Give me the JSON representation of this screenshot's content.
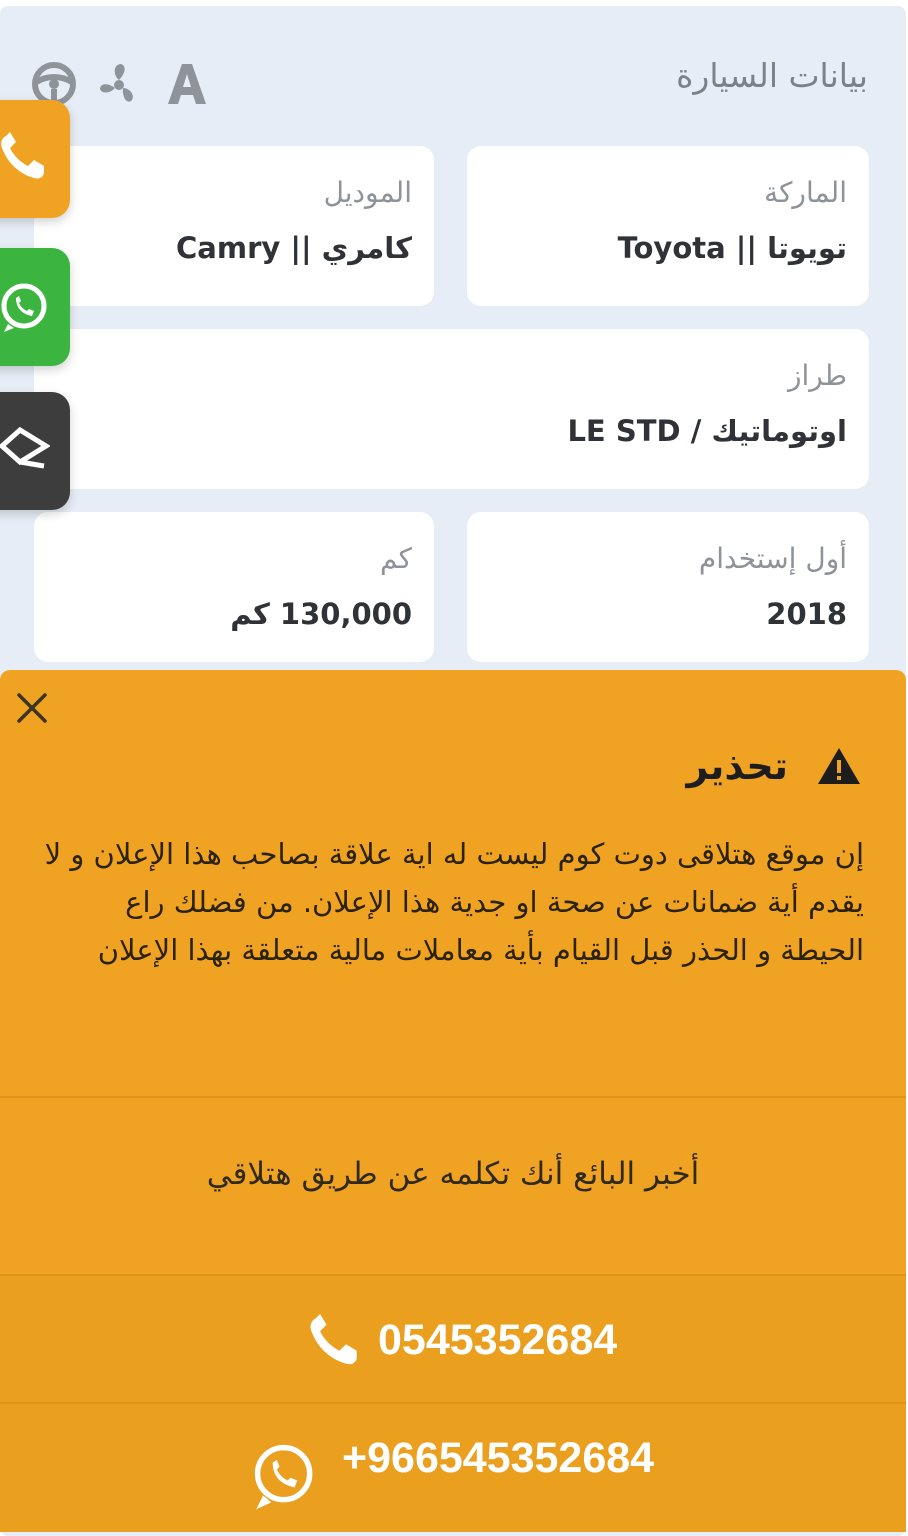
{
  "section": {
    "title": "بيانات السيارة",
    "spec_icons": [
      "steering-wheel-icon",
      "fan-icon",
      "letter-a-icon"
    ]
  },
  "fields": {
    "make": {
      "label": "الماركة",
      "value": "تويوتا || Toyota"
    },
    "model": {
      "label": "الموديل",
      "value": "كامري || Camry"
    },
    "trim": {
      "label": "طراز",
      "value": "اوتوماتيك / LE STD"
    },
    "first_use": {
      "label": "أول إستخدام",
      "value": "2018"
    },
    "km": {
      "label": "كم",
      "value": "130,000 كم"
    }
  },
  "floating_buttons": [
    {
      "icon": "phone-icon",
      "color": "#f0a322"
    },
    {
      "icon": "whatsapp-icon",
      "color": "#3bb53f"
    },
    {
      "icon": "share-icon",
      "color": "#3d3d3d"
    }
  ],
  "warning": {
    "title": "تحذير",
    "body": "إن موقع هتلاقى دوت كوم ليست له اية علاقة بصاحب هذا الإعلان و لا يقدم أية ضمانات عن صحة او جدية هذا الإعلان. من فضلك راع الحيطة و الحذر قبل القيام بأية معاملات مالية متعلقة بهذا الإعلان",
    "tell_seller": "أخبر البائع أنك تكلمه عن طريق هتلاقي",
    "phone": "0545352684",
    "whatsapp": "+966545352684"
  },
  "colors": {
    "background": "#e7edf6",
    "warning": "#f0a322",
    "whatsapp": "#3bb53f"
  }
}
